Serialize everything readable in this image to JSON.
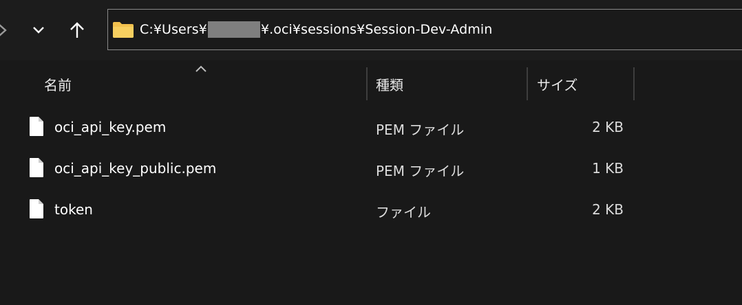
{
  "address_bar": {
    "path_prefix": "C:¥Users¥",
    "path_suffix": "¥.oci¥sessions¥Session-Dev-Admin"
  },
  "columns": {
    "name": "名前",
    "type": "種類",
    "size": "サイズ"
  },
  "files": [
    {
      "name": "oci_api_key.pem",
      "type": "PEM ファイル",
      "size": "2 KB"
    },
    {
      "name": "oci_api_key_public.pem",
      "type": "PEM ファイル",
      "size": "1 KB"
    },
    {
      "name": "token",
      "type": "ファイル",
      "size": "2 KB"
    }
  ],
  "colors": {
    "background": "#191919",
    "folder": "#f2c14e",
    "text": "#ffffff",
    "redaction": "#7f7f7f"
  },
  "icons": {
    "forward": "chevron-right-icon",
    "recent": "chevron-down-icon",
    "up": "arrow-up-icon",
    "folder": "folder-icon",
    "file": "file-icon",
    "sort": "sort-ascending-icon"
  }
}
